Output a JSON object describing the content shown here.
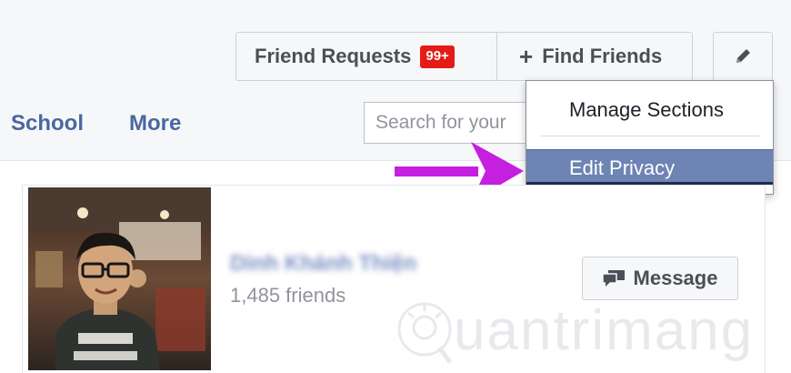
{
  "header": {
    "friend_requests_label": "Friend Requests",
    "friend_requests_badge": "99+",
    "find_friends_label": "Find Friends",
    "find_friends_icon": "plus-icon",
    "edit_icon": "pencil-icon"
  },
  "nav": {
    "school_label": "School",
    "more_label": "More"
  },
  "search": {
    "placeholder": "Search for your"
  },
  "dropdown": {
    "items": [
      {
        "label": "Manage Sections",
        "selected": false
      },
      {
        "label": "Edit Privacy",
        "selected": true
      }
    ]
  },
  "annotation": {
    "arrow_color": "#c51fe0"
  },
  "friend_card": {
    "name": "Dinh Khánh Thiện",
    "friend_count": "1,485 friends",
    "message_label": "Message",
    "message_icon": "speech-bubble-icon"
  },
  "watermark": {
    "text": "uantrimang"
  },
  "colors": {
    "badge": "#e41b17",
    "link": "#4b67a1",
    "dropdown_highlight": "#6d84b4"
  }
}
